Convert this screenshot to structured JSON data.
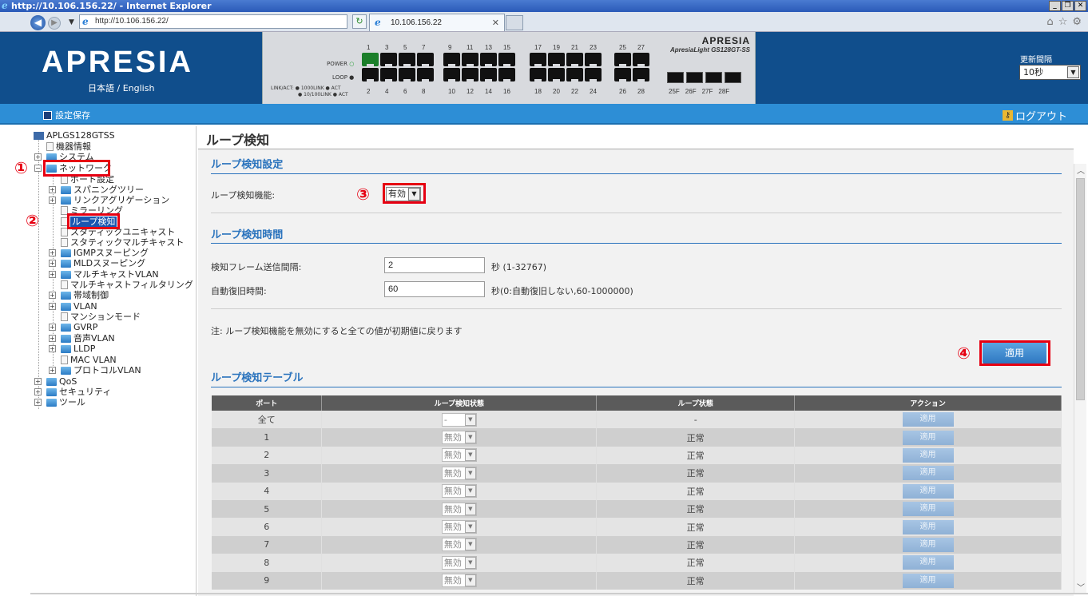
{
  "window": {
    "title": "http://10.106.156.22/ - Internet Explorer",
    "controls": [
      "_",
      "❐",
      "✕"
    ]
  },
  "browser": {
    "url": "http://10.106.156.22/",
    "tab_title": "10.106.156.22"
  },
  "header": {
    "logo": "APRESIA",
    "language": "日本語 / English",
    "device_brand": "APRESIA",
    "device_model": "ApresiaLight GS128GT-SS",
    "led_labels": [
      "POWER",
      "LOOP"
    ],
    "led_legend": [
      "LINK/ACT: ● 1000LINK ● ACT",
      "● 10/100LINK ● ACT"
    ],
    "ports_top": [
      "1",
      "3",
      "5",
      "7",
      "9",
      "11",
      "13",
      "15",
      "17",
      "19",
      "21",
      "23",
      "25",
      "27"
    ],
    "ports_bottom": [
      "2",
      "4",
      "6",
      "8",
      "10",
      "12",
      "14",
      "16",
      "18",
      "20",
      "22",
      "24",
      "26",
      "28"
    ],
    "sfp_labels": [
      "25F",
      "26F",
      "27F",
      "28F"
    ],
    "refresh_label": "更新間隔",
    "refresh_value": "10秒"
  },
  "toolbar": {
    "save_label": "設定保存",
    "logout_label": "ログアウト"
  },
  "tree": {
    "root": "APLGS128GTSS",
    "items": [
      "機器情報",
      "システム",
      "ネットワーク",
      "ポート設定",
      "スパニングツリー",
      "リンクアグリゲーション",
      "ミラーリング",
      "ループ検知",
      "スタティックユニキャスト",
      "スタティックマルチキャスト",
      "IGMPスヌーピング",
      "MLDスヌーピング",
      "マルチキャストVLAN",
      "マルチキャストフィルタリング",
      "帯域制御",
      "VLAN",
      "マンションモード",
      "GVRP",
      "音声VLAN",
      "LLDP",
      "MAC VLAN",
      "プロトコルVLAN",
      "QoS",
      "セキュリティ",
      "ツール"
    ]
  },
  "annotations": [
    "①",
    "②",
    "③",
    "④"
  ],
  "main": {
    "title": "ループ検知",
    "section1_title": "ループ検知設定",
    "enable_label": "ループ検知機能:",
    "enable_value": "有効",
    "section2_title": "ループ検知時間",
    "interval_label": "検知フレーム送信間隔:",
    "interval_value": "2",
    "interval_hint": "秒 (1-32767)",
    "recovery_label": "自動復旧時間:",
    "recovery_value": "60",
    "recovery_hint": "秒(0:自動復旧しない,60-1000000)",
    "note": "注: ループ検知機能を無効にすると全ての値が初期値に戻ります",
    "apply_label": "適用",
    "section3_title": "ループ検知テーブル",
    "table_headers": [
      "ポート",
      "ループ検知状態",
      "ループ状態",
      "アクション"
    ],
    "table_rows": [
      {
        "port": "全て",
        "detect": "-",
        "state": "-",
        "action": "適用"
      },
      {
        "port": "1",
        "detect": "無効",
        "state": "正常",
        "action": "適用"
      },
      {
        "port": "2",
        "detect": "無効",
        "state": "正常",
        "action": "適用"
      },
      {
        "port": "3",
        "detect": "無効",
        "state": "正常",
        "action": "適用"
      },
      {
        "port": "4",
        "detect": "無効",
        "state": "正常",
        "action": "適用"
      },
      {
        "port": "5",
        "detect": "無効",
        "state": "正常",
        "action": "適用"
      },
      {
        "port": "6",
        "detect": "無効",
        "state": "正常",
        "action": "適用"
      },
      {
        "port": "7",
        "detect": "無効",
        "state": "正常",
        "action": "適用"
      },
      {
        "port": "8",
        "detect": "無効",
        "state": "正常",
        "action": "適用"
      },
      {
        "port": "9",
        "detect": "無効",
        "state": "正常",
        "action": "適用"
      }
    ]
  }
}
